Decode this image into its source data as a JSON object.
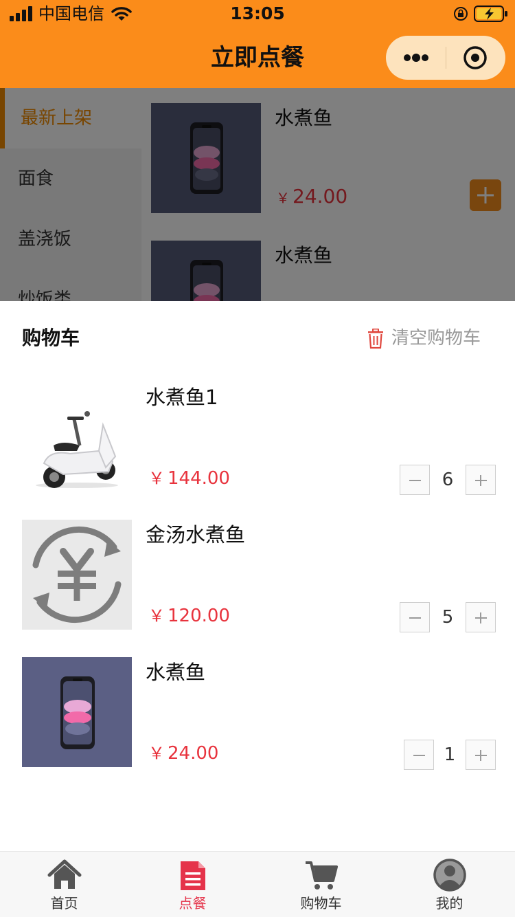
{
  "status_bar": {
    "carrier": "中国电信",
    "time": "13:05"
  },
  "nav": {
    "title": "立即点餐",
    "icons": [
      "more-dots-icon",
      "close-circle-icon"
    ]
  },
  "colors": {
    "brand_orange": "#fb8c1a",
    "accent_orange": "#f08a00",
    "price_red": "#e8333d",
    "tab_active": "#e5334a"
  },
  "categories": [
    {
      "label": "最新上架",
      "active": true
    },
    {
      "label": "面食",
      "active": false
    },
    {
      "label": "盖浇饭",
      "active": false
    },
    {
      "label": "炒饭类",
      "active": false
    }
  ],
  "menu_items": [
    {
      "name": "水煮鱼",
      "currency": "￥",
      "price": "24.00",
      "image_icon": "phone-photo-icon"
    },
    {
      "name": "水煮鱼",
      "image_icon": "phone-photo-icon"
    }
  ],
  "cart": {
    "title": "购物车",
    "clear_label": "清空购物车",
    "items": [
      {
        "name": "水煮鱼1",
        "currency": "￥",
        "price": "144.00",
        "qty": "6",
        "image_icon": "scooter-photo-icon"
      },
      {
        "name": "金汤水煮鱼",
        "currency": "￥",
        "price": "120.00",
        "qty": "5",
        "image_icon": "yen-placeholder-icon"
      },
      {
        "name": "水煮鱼",
        "currency": "￥",
        "price": "24.00",
        "qty": "1",
        "image_icon": "phone-photo-icon"
      }
    ]
  },
  "tabbar": [
    {
      "label": "首页",
      "icon": "home-icon",
      "active": false
    },
    {
      "label": "点餐",
      "icon": "order-document-icon",
      "active": true
    },
    {
      "label": "购物车",
      "icon": "cart-icon",
      "active": false
    },
    {
      "label": "我的",
      "icon": "profile-icon",
      "active": false
    }
  ]
}
